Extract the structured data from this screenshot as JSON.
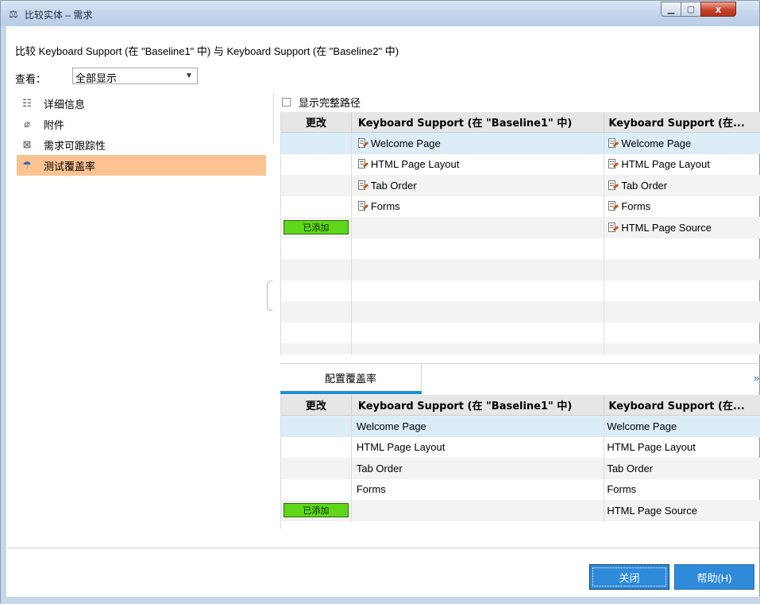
{
  "window": {
    "title": "比较实体 – 需求",
    "icon": "balance-scale-icon",
    "controls": {
      "minimize_icon": "minimize-icon",
      "maximize_icon": "maximize-icon",
      "close_label": "x"
    }
  },
  "compare_description": "比较 Keyboard Support (在 \"Baseline1\" 中) 与 Keyboard Support (在 \"Baseline2\" 中)",
  "view": {
    "label": "查看：",
    "selected": "全部显示"
  },
  "nav": {
    "items": [
      {
        "label": "详细信息",
        "icon": "details-icon",
        "selected": false
      },
      {
        "label": "附件",
        "icon": "paperclip-icon",
        "selected": false
      },
      {
        "label": "需求可跟踪性",
        "icon": "traceability-icon",
        "selected": false
      },
      {
        "label": "测试覆盖率",
        "icon": "umbrella-icon",
        "selected": true
      }
    ]
  },
  "show_full_path": {
    "label": "显示完整路径",
    "checked": false
  },
  "grid1": {
    "columns": [
      "更改",
      "Keyboard Support (在 \"Baseline1\" 中)",
      "Keyboard Support (在..."
    ],
    "rows": [
      {
        "change": "",
        "left": "Welcome Page",
        "right": "Welcome Page"
      },
      {
        "change": "",
        "left": "HTML Page Layout",
        "right": "HTML Page Layout"
      },
      {
        "change": "",
        "left": "Tab Order",
        "right": "Tab Order"
      },
      {
        "change": "",
        "left": "Forms",
        "right": "Forms"
      },
      {
        "change": "已添加",
        "left": "",
        "right": "HTML Page Source"
      }
    ]
  },
  "coverage_tab": {
    "label": "配置覆盖率",
    "expand_icon": "double-chevron-down-icon"
  },
  "grid2": {
    "columns": [
      "更改",
      "Keyboard Support (在 \"Baseline1\" 中)",
      "Keyboard Support (在..."
    ],
    "rows": [
      {
        "change": "",
        "left": "Welcome Page",
        "right": "Welcome Page"
      },
      {
        "change": "",
        "left": "HTML Page Layout",
        "right": "HTML Page Layout"
      },
      {
        "change": "",
        "left": "Tab Order",
        "right": "Tab Order"
      },
      {
        "change": "",
        "left": "Forms",
        "right": "Forms"
      },
      {
        "change": "已添加",
        "left": "",
        "right": "HTML Page Source"
      }
    ]
  },
  "buttons": {
    "close": "关闭",
    "help": "帮助(H)"
  },
  "colors": {
    "added_badge": "#5ed619",
    "selected_nav": "#fbc391",
    "selected_row": "#dcedf8",
    "button": "#2f8ad9"
  }
}
